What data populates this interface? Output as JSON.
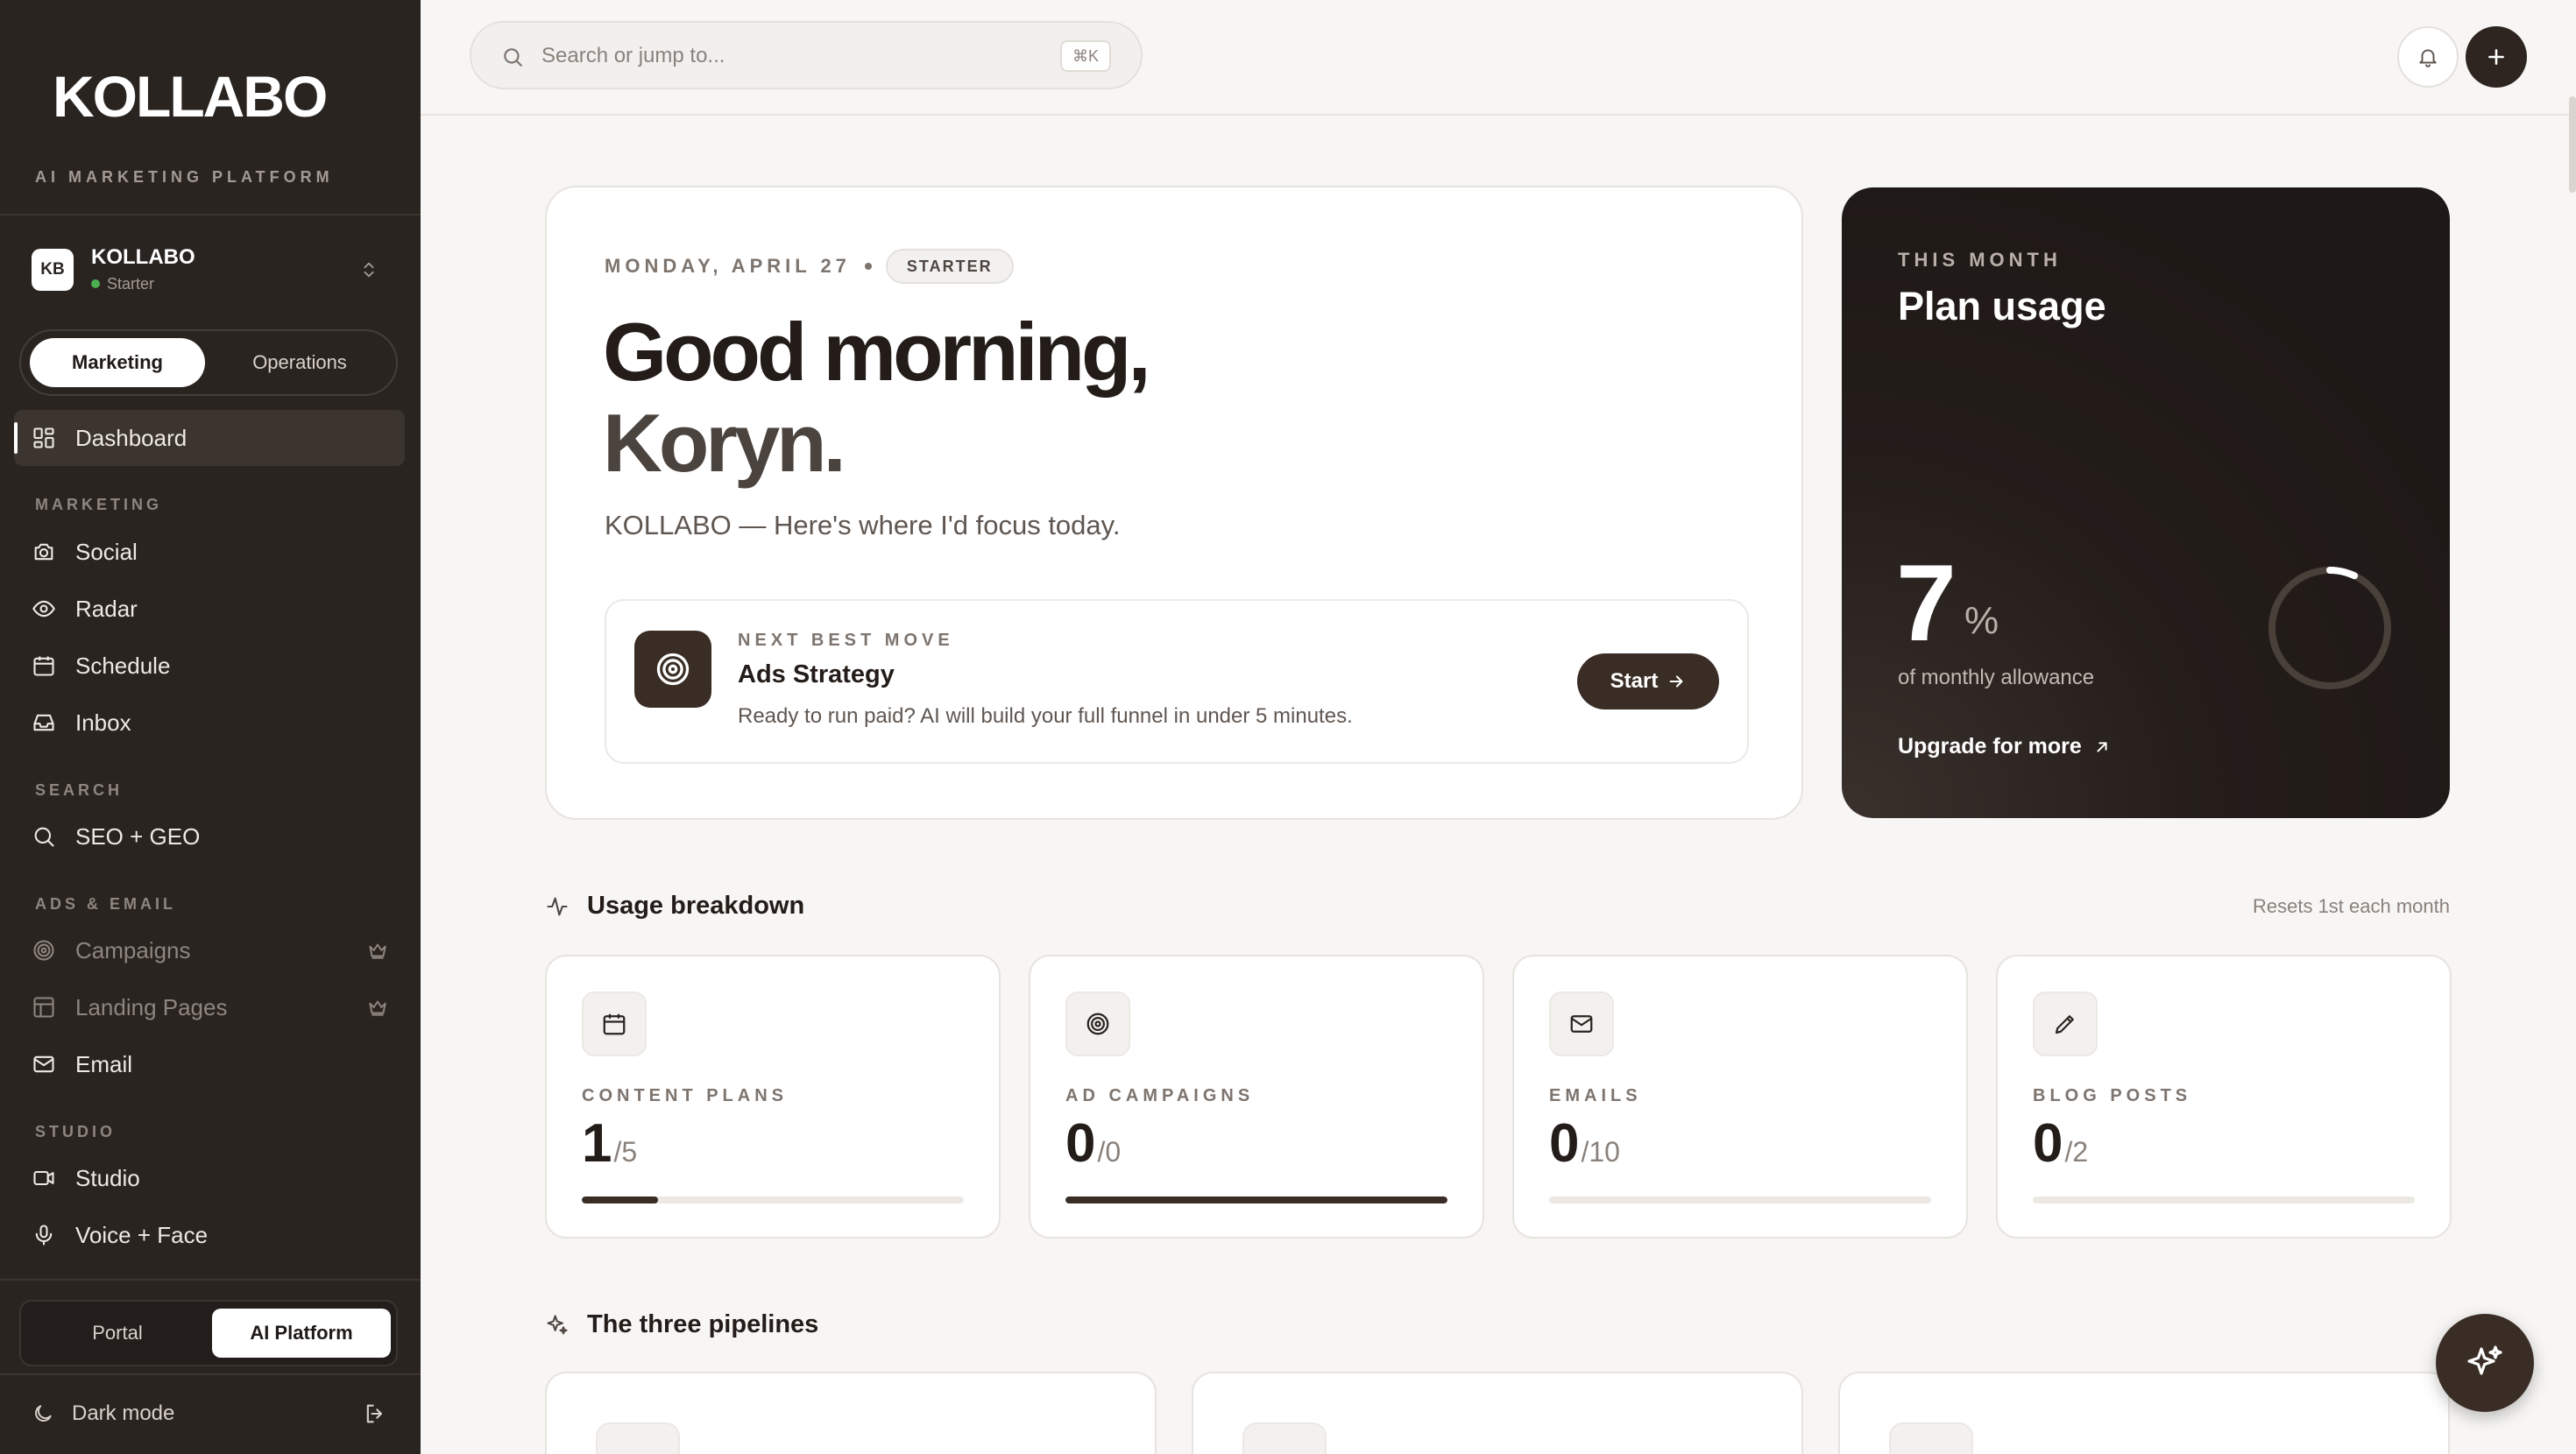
{
  "brand": {
    "logo": "KOLLABO",
    "tagline": "AI MARKETING PLATFORM"
  },
  "workspace": {
    "badge": "KB",
    "name": "KOLLABO",
    "plan": "Starter"
  },
  "mode_toggle": {
    "options": [
      "Marketing",
      "Operations"
    ],
    "selected": "Marketing"
  },
  "nav": {
    "dashboard": "Dashboard",
    "sections": {
      "marketing": "MARKETING",
      "search": "SEARCH",
      "ads_email": "ADS & EMAIL",
      "studio": "STUDIO"
    },
    "items": {
      "social": "Social",
      "radar": "Radar",
      "schedule": "Schedule",
      "inbox": "Inbox",
      "seo": "SEO + GEO",
      "campaigns": "Campaigns",
      "landing": "Landing Pages",
      "email": "Email",
      "studio": "Studio",
      "voice": "Voice + Face"
    }
  },
  "platform_toggle": {
    "options": [
      "Portal",
      "AI Platform"
    ],
    "selected": "AI Platform"
  },
  "dark_mode": "Dark mode",
  "search": {
    "placeholder": "Search or jump to...",
    "shortcut": "⌘K"
  },
  "hero": {
    "date": "MONDAY, APRIL 27",
    "tier": "STARTER",
    "greeting_line1": "Good morning,",
    "greeting_line2": "Koryn.",
    "subtitle": "KOLLABO — Here's where I'd focus today.",
    "next_move": {
      "kicker": "NEXT BEST MOVE",
      "title": "Ads Strategy",
      "description": "Ready to run paid? AI will build your full funnel in under 5 minutes.",
      "button": "Start"
    }
  },
  "plan_usage": {
    "kicker": "THIS MONTH",
    "title": "Plan usage",
    "percent": "7",
    "percent_sign": "%",
    "percent_value": 7,
    "caption": "of monthly allowance",
    "upgrade": "Upgrade for more"
  },
  "usage": {
    "title": "Usage breakdown",
    "resets": "Resets 1st each month",
    "cards": [
      {
        "label": "CONTENT PLANS",
        "used": "1",
        "limit": "/5",
        "fill": 0.2,
        "icon": "calendar-icon"
      },
      {
        "label": "AD CAMPAIGNS",
        "used": "0",
        "limit": "/0",
        "fill": 1.0,
        "icon": "target-icon"
      },
      {
        "label": "EMAILS",
        "used": "0",
        "limit": "/10",
        "fill": 0,
        "icon": "mail-icon"
      },
      {
        "label": "BLOG POSTS",
        "used": "0",
        "limit": "/2",
        "fill": 0,
        "icon": "pen-icon"
      }
    ]
  },
  "pipelines": {
    "title": "The three pipelines"
  },
  "colors": {
    "sidebar": "#2a2420",
    "accent": "#3a2d25",
    "background": "#f7f6f4",
    "status_online": "#4caf50"
  }
}
